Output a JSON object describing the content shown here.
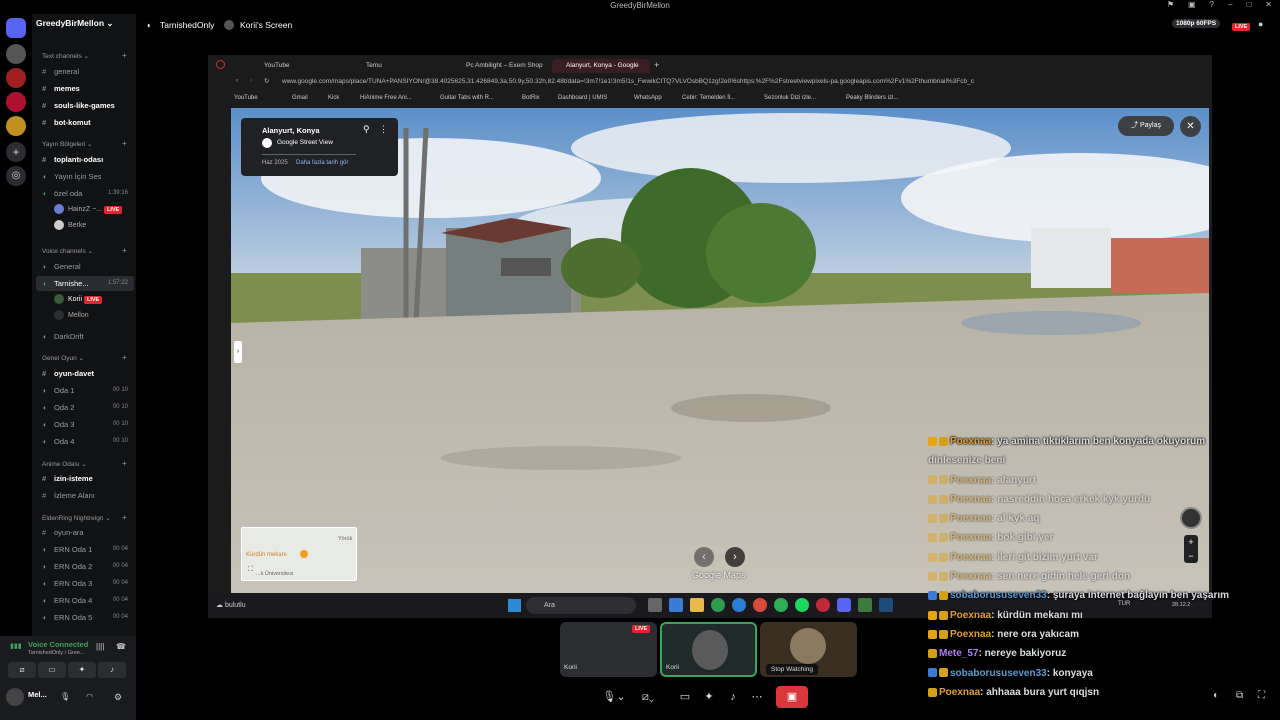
{
  "titlebar": {
    "title": "GreedyBirMellon"
  },
  "server": {
    "name": "GreedyBirMellon"
  },
  "channels": {
    "text_category": "Text channels",
    "text": [
      "general",
      "memes",
      "souls-like-games",
      "bot-komut"
    ],
    "broadcast_category": "Yayın Bölgeleri",
    "broadcast": [
      "toplantı-odası",
      "Yayın İçin Ses",
      "özel oda"
    ],
    "ozel_time": "1:39:16",
    "ozel_users": [
      "HainzZ ~...",
      "Berke"
    ],
    "voice_category": "Voice channels",
    "voice_general": "General",
    "tarnished": "Tarnishe...",
    "tarnished_time": "1:57:22",
    "tarnished_users": [
      "Korii",
      "Mellon"
    ],
    "darkdrift": "DarkDrift",
    "game_category": "Genel Oyun",
    "game_text": "oyun-davet",
    "rooms": [
      "Oda 1",
      "Oda 2",
      "Oda 3",
      "Oda 4"
    ],
    "anime_category": "Anime Odası",
    "anime": [
      "izin-isteme",
      "İzleme Alanı"
    ],
    "elden_category": "EldenRing Nightreign",
    "elden_text": "oyun-ara",
    "ern": [
      "ERN Oda 1",
      "ERN Oda 2",
      "ERN Oda 3",
      "ERN Oda 4",
      "ERN Oda 5"
    ],
    "count_00": "00",
    "count_10": "10",
    "count_04": "04",
    "live": "LIVE"
  },
  "voice": {
    "status": "Voice Connected",
    "channel": "TarnishedOnly / Gree...",
    "user": "Mel..."
  },
  "topbar": {
    "channel": "TarnishedOnly",
    "screen": "Korii's Screen",
    "quality": "1080p 60FPS",
    "live": "LIVE"
  },
  "browser": {
    "tabs": [
      "YouTube",
      "Temu",
      "Pc Ambilight – Exem Shop",
      "Alanyurt, Konya - Google"
    ],
    "url": "www.google.com/maps/place/TUNA+PANSİYON/@38.4025625,31.426849,3a,50.9y,50.32h,82.48t/data=!3m7!1e1!3m5!1s_FwwikCITQ7VLVOsbBQ1zg!2e0!6shttps:%2F%2Fstreetviewpixels-pa.googleapis.com%2Fv1%2Fthumbnail%3Fcb_c",
    "bookmarks": [
      "YouTube",
      "Gmail",
      "Kick",
      "HiAnime Free Ani...",
      "Guitar Tabs with R...",
      "BotRix",
      "Dashboard | UMIS",
      "WhatsApp",
      "Cebir: Temelden İl...",
      "Sezonluk Dizi izle...",
      "Peaky Blinders izl..."
    ]
  },
  "streetview": {
    "place": "Alanyurt, Konya",
    "provider": "Google Street View",
    "date": "Haz 2025",
    "more": "Daha fazla tarih gör",
    "share": "Paylaş",
    "watermark": "Google Maps",
    "map_label": "Kürdün mekanı",
    "map_label2": "Yörük",
    "map_label3": "...k Üniversitesi"
  },
  "taskbar": {
    "search": "Ara",
    "lang": "TUR",
    "date": "28.12.2",
    "weather": "bulutlu"
  },
  "chat": [
    {
      "user": "Poexnaa",
      "color": "#e0a030",
      "text": ": ya amina tıktıklarım ben konyada okuyorum"
    },
    {
      "user": "",
      "color": "#e0a030",
      "text": "dinlesenize beni"
    },
    {
      "user": "Poexnaa",
      "color": "#e0a030",
      "text": ": alanyurt"
    },
    {
      "user": "Poexnaa",
      "color": "#e0a030",
      "text": ": nasreddin hoca erkek kyk yurdu"
    },
    {
      "user": "Poexnaa",
      "color": "#e0a030",
      "text": ": al kyk aq"
    },
    {
      "user": "Poexnaa",
      "color": "#e0a030",
      "text": ": bok gibi yer"
    },
    {
      "user": "Poexnaa",
      "color": "#e0a030",
      "text": ": ileri git bizim yurt var"
    },
    {
      "user": "Poexnaa",
      "color": "#e0a030",
      "text": ": sen nere gidin hele geri don"
    },
    {
      "user": "sobaborususeven33",
      "color": "#5b9bd5",
      "text": ": şuraya internet bağlayın ben yaşarım"
    },
    {
      "user": "Poexnaa",
      "color": "#e0a030",
      "text": ": kürdün mekanı mı"
    },
    {
      "user": "Poexnaa",
      "color": "#e0a030",
      "text": ": nere ora yakıcam"
    },
    {
      "user": "Mete_57",
      "color": "#b07cf0",
      "text": ": nereye bakiyoruz"
    },
    {
      "user": "sobaborususeven33",
      "color": "#5b9bd5",
      "text": ": konyaya"
    },
    {
      "user": "Poexnaa",
      "color": "#e0a030",
      "text": ": ahhaaa bura yurt qıqjsn"
    }
  ],
  "thumbs": {
    "korii": "Korii",
    "live": "LIVE",
    "tooltip": "Stop Watching"
  }
}
